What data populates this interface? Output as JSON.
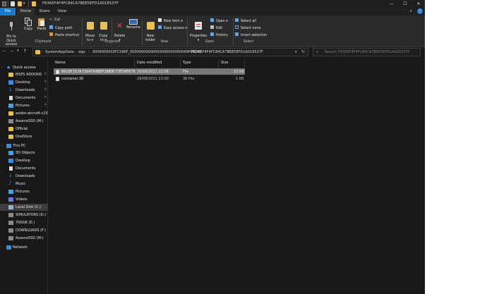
{
  "title": "F6365F4F4FC84CA7BEE5EFD1A01E537F",
  "window_controls": {
    "minimize": "—",
    "maximize": "☐",
    "close": "✕"
  },
  "tabs": [
    "File",
    "Home",
    "Share",
    "View"
  ],
  "ribbon": {
    "clipboard": {
      "pin": "Pin to Quick\naccess",
      "copy": "Copy",
      "paste": "Paste",
      "cut": "Cut",
      "copy_path": "Copy path",
      "paste_shortcut": "Paste shortcut",
      "group": "Clipboard"
    },
    "organise": {
      "move_to": "Move\nto ▾",
      "copy_to": "Copy\nto ▾",
      "delete": "Delete\n▾",
      "rename": "Rename",
      "group": "Organise"
    },
    "new": {
      "new_folder": "New\nfolder",
      "new_item": "New item ▾",
      "easy_access": "Easy access ▾",
      "group": "New"
    },
    "open": {
      "properties": "Properties\n▾",
      "open": "Open ▾",
      "edit": "Edit",
      "history": "History",
      "group": "Open"
    },
    "select": {
      "select_all": "Select all",
      "select_none": "Select none",
      "invert": "Invert selection",
      "group": "Select"
    }
  },
  "address": {
    "crumbs": [
      "SystemAppData",
      "wgs",
      "0009000003FC566F_00000000000000000000000069F80140",
      "F6365F4F4FC84CA7BEE5EFD1A01E537F"
    ],
    "search_placeholder": "Search F6365F4F4FC84CA7BEE5EFD1A01E537F"
  },
  "nav": {
    "quick_access": "Quick access",
    "quick_items": [
      "MSFS ADDONS",
      "Desktop",
      "Downloads",
      "Documents",
      "Pictures",
      "asobo-aircraft-c152",
      "AssenoSSD (M:)",
      "Official",
      "OneStore"
    ],
    "this_pc": "This PC",
    "pc_items": [
      "3D Objects",
      "Desktop",
      "Documents",
      "Downloads",
      "Music",
      "Pictures",
      "Videos",
      "Local Disk (C:)",
      "SIMULATORS (D:)",
      "700GB (E:)",
      "DOWNLOADS (F:)",
      "AssenoSSD (M:)"
    ],
    "network": "Network"
  },
  "columns": [
    "Name",
    "Date modified",
    "Type",
    "Size"
  ],
  "files": [
    {
      "name": "6619F157A7164783B9F18B9C73F56FE76",
      "date": "29/08/2021 22:58",
      "type": "File",
      "size": "15 KB"
    },
    {
      "name": "container.36",
      "date": "29/08/2021 23:00",
      "type": "36 File",
      "size": "1 KB"
    }
  ],
  "colors": {
    "accent": "#1979ca",
    "background": "#191919",
    "ribbon": "#2b2b2b",
    "folder": "#e8c054"
  }
}
